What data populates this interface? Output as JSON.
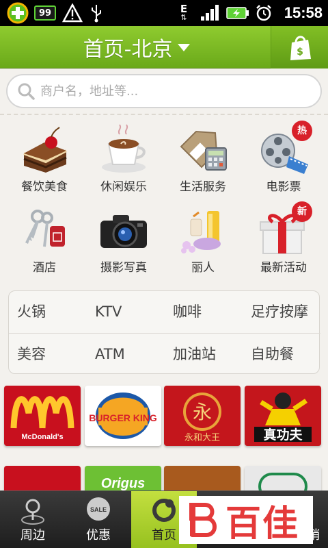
{
  "status_bar": {
    "badge_value": "99",
    "network_type": "E",
    "time": "15:58",
    "icons": [
      "app-plus-icon",
      "battery-badge-icon",
      "warning-icon",
      "usb-icon",
      "edge-data-icon",
      "signal-icon",
      "battery-charging-icon",
      "alarm-icon"
    ]
  },
  "header": {
    "title": "首页-北京",
    "scan_icon": "shopping-bag-icon"
  },
  "search": {
    "placeholder": "商户名，地址等..."
  },
  "categories": [
    {
      "label": "餐饮美食",
      "icon": "cake-icon"
    },
    {
      "label": "休闲娱乐",
      "icon": "coffee-icon"
    },
    {
      "label": "生活服务",
      "icon": "tag-calculator-icon"
    },
    {
      "label": "电影票",
      "icon": "film-reel-icon",
      "badge": "热"
    },
    {
      "label": "酒店",
      "icon": "keys-icon"
    },
    {
      "label": "摄影写真",
      "icon": "camera-icon"
    },
    {
      "label": "丽人",
      "icon": "cosmetics-icon"
    },
    {
      "label": "最新活动",
      "icon": "gift-icon",
      "badge": "新"
    }
  ],
  "keywords": {
    "row1": [
      "火锅",
      "KTV",
      "咖啡",
      "足疗按摩"
    ],
    "row2": [
      "美容",
      "ATM",
      "加油站",
      "自助餐"
    ]
  },
  "brands": {
    "mcdonalds": "McDonald's",
    "burger_king": "BURGER KING",
    "yonghe": "永和大王",
    "yonghe_logo": "永",
    "zhengongfu": "真功夫",
    "origus": "Origus"
  },
  "tabbar": {
    "tabs": [
      {
        "label": "周边",
        "icon": "map-pin-icon"
      },
      {
        "label": "优惠",
        "icon": "sale-tag-icon",
        "icon_text": "SALE"
      },
      {
        "label": "首页",
        "icon": "home-icon"
      },
      {
        "label": "",
        "icon": "unknown"
      },
      {
        "label": "销",
        "icon": "unknown"
      }
    ]
  },
  "watermark": "百佳",
  "colors": {
    "header_green": "#7bb925",
    "active_tab": "#b5d52f",
    "badge_red": "#d8212a",
    "mcdonalds_red": "#c8101e",
    "mcdonalds_yellow": "#ffc72c"
  }
}
